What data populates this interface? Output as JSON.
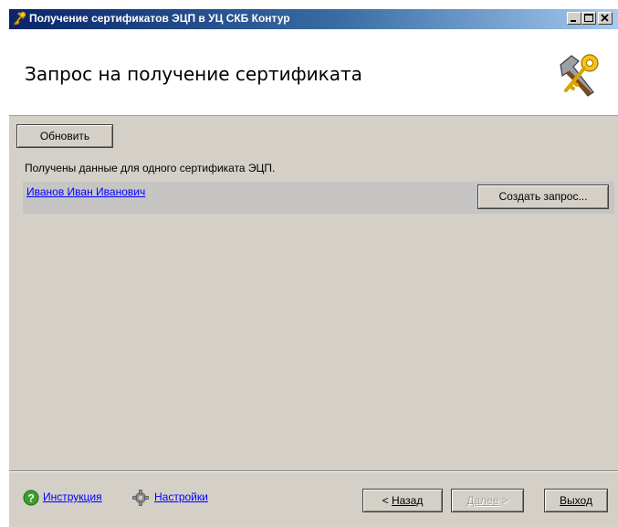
{
  "window": {
    "title": "Получение сертификатов ЭЦП в УЦ СКБ Контур",
    "controls": [
      "minimize",
      "maximize",
      "close"
    ]
  },
  "header": {
    "title": "Запрос на получение сертификата",
    "icon": "hammer-key-icon"
  },
  "main": {
    "refresh_label": "Обновить",
    "info_text": "Получены данные для одного сертификата ЭЦП.",
    "certificates": [
      {
        "name": "Иванов Иван Иванович",
        "action_label": "Создать запрос..."
      }
    ]
  },
  "footer": {
    "help_label": "Инструкция",
    "settings_label": "Настройки",
    "back_label": "Назад",
    "next_label": "Далее",
    "exit_label": "Выход"
  },
  "colors": {
    "window_bg": "#d4d0c8",
    "link": "#0000ff",
    "row_bg": "#c6c5c3"
  }
}
